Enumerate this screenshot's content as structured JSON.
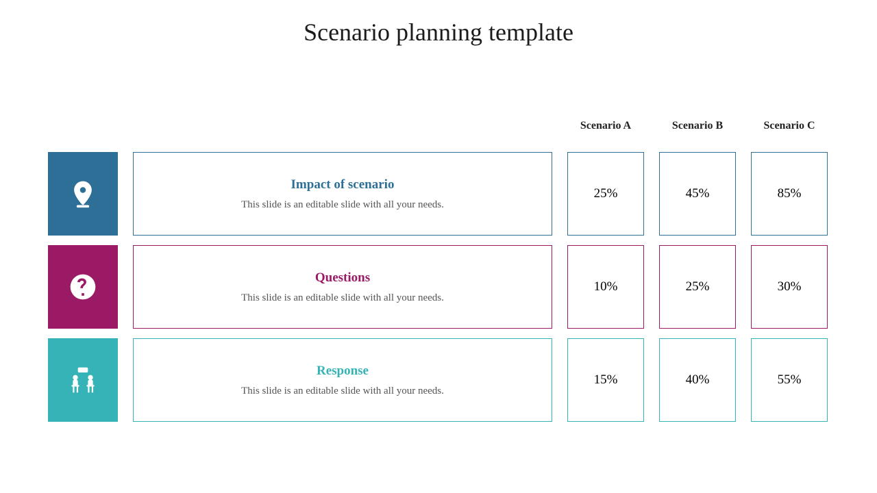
{
  "title": "Scenario planning template",
  "columns": [
    "Scenario A",
    "Scenario B",
    "Scenario C"
  ],
  "rows": [
    {
      "icon": "pin-icon",
      "title": "Impact of scenario",
      "desc": "This slide is an editable slide with all your needs.",
      "values": [
        "25%",
        "45%",
        "85%"
      ],
      "color": "#2d6f97"
    },
    {
      "icon": "question-icon",
      "title": "Questions",
      "desc": "This slide is an editable slide with all your needs.",
      "values": [
        "10%",
        "25%",
        "30%"
      ],
      "color": "#9a1a65"
    },
    {
      "icon": "discussion-icon",
      "title": "Response",
      "desc": "This slide is an editable slide with all your needs.",
      "values": [
        "15%",
        "40%",
        "55%"
      ],
      "color": "#36b3b6"
    }
  ],
  "chart_data": {
    "type": "table",
    "title": "Scenario planning template",
    "row_labels": [
      "Impact of scenario",
      "Questions",
      "Response"
    ],
    "columns": [
      "Scenario A",
      "Scenario B",
      "Scenario C"
    ],
    "series": [
      {
        "name": "Impact of scenario",
        "values": [
          25,
          45,
          85
        ]
      },
      {
        "name": "Questions",
        "values": [
          10,
          25,
          30
        ]
      },
      {
        "name": "Response",
        "values": [
          15,
          40,
          55
        ]
      }
    ],
    "unit": "%",
    "xlabel": "",
    "ylabel": "",
    "ylim": [
      0,
      100
    ]
  }
}
